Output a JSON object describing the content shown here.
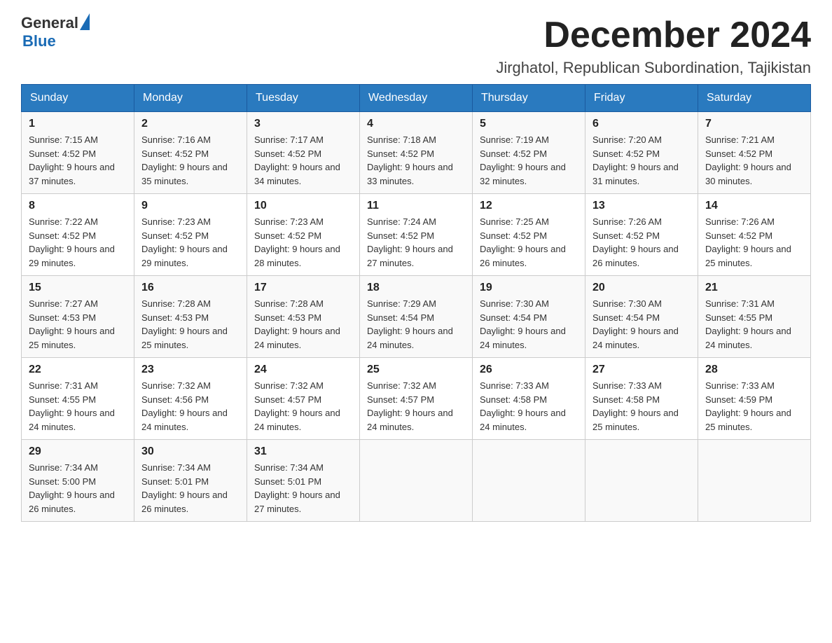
{
  "header": {
    "logo_text_general": "General",
    "logo_text_blue": "Blue",
    "month_title": "December 2024",
    "location": "Jirghatol, Republican Subordination, Tajikistan"
  },
  "days_of_week": [
    "Sunday",
    "Monday",
    "Tuesday",
    "Wednesday",
    "Thursday",
    "Friday",
    "Saturday"
  ],
  "weeks": [
    [
      {
        "day": "1",
        "sunrise": "7:15 AM",
        "sunset": "4:52 PM",
        "daylight": "9 hours and 37 minutes."
      },
      {
        "day": "2",
        "sunrise": "7:16 AM",
        "sunset": "4:52 PM",
        "daylight": "9 hours and 35 minutes."
      },
      {
        "day": "3",
        "sunrise": "7:17 AM",
        "sunset": "4:52 PM",
        "daylight": "9 hours and 34 minutes."
      },
      {
        "day": "4",
        "sunrise": "7:18 AM",
        "sunset": "4:52 PM",
        "daylight": "9 hours and 33 minutes."
      },
      {
        "day": "5",
        "sunrise": "7:19 AM",
        "sunset": "4:52 PM",
        "daylight": "9 hours and 32 minutes."
      },
      {
        "day": "6",
        "sunrise": "7:20 AM",
        "sunset": "4:52 PM",
        "daylight": "9 hours and 31 minutes."
      },
      {
        "day": "7",
        "sunrise": "7:21 AM",
        "sunset": "4:52 PM",
        "daylight": "9 hours and 30 minutes."
      }
    ],
    [
      {
        "day": "8",
        "sunrise": "7:22 AM",
        "sunset": "4:52 PM",
        "daylight": "9 hours and 29 minutes."
      },
      {
        "day": "9",
        "sunrise": "7:23 AM",
        "sunset": "4:52 PM",
        "daylight": "9 hours and 29 minutes."
      },
      {
        "day": "10",
        "sunrise": "7:23 AM",
        "sunset": "4:52 PM",
        "daylight": "9 hours and 28 minutes."
      },
      {
        "day": "11",
        "sunrise": "7:24 AM",
        "sunset": "4:52 PM",
        "daylight": "9 hours and 27 minutes."
      },
      {
        "day": "12",
        "sunrise": "7:25 AM",
        "sunset": "4:52 PM",
        "daylight": "9 hours and 26 minutes."
      },
      {
        "day": "13",
        "sunrise": "7:26 AM",
        "sunset": "4:52 PM",
        "daylight": "9 hours and 26 minutes."
      },
      {
        "day": "14",
        "sunrise": "7:26 AM",
        "sunset": "4:52 PM",
        "daylight": "9 hours and 25 minutes."
      }
    ],
    [
      {
        "day": "15",
        "sunrise": "7:27 AM",
        "sunset": "4:53 PM",
        "daylight": "9 hours and 25 minutes."
      },
      {
        "day": "16",
        "sunrise": "7:28 AM",
        "sunset": "4:53 PM",
        "daylight": "9 hours and 25 minutes."
      },
      {
        "day": "17",
        "sunrise": "7:28 AM",
        "sunset": "4:53 PM",
        "daylight": "9 hours and 24 minutes."
      },
      {
        "day": "18",
        "sunrise": "7:29 AM",
        "sunset": "4:54 PM",
        "daylight": "9 hours and 24 minutes."
      },
      {
        "day": "19",
        "sunrise": "7:30 AM",
        "sunset": "4:54 PM",
        "daylight": "9 hours and 24 minutes."
      },
      {
        "day": "20",
        "sunrise": "7:30 AM",
        "sunset": "4:54 PM",
        "daylight": "9 hours and 24 minutes."
      },
      {
        "day": "21",
        "sunrise": "7:31 AM",
        "sunset": "4:55 PM",
        "daylight": "9 hours and 24 minutes."
      }
    ],
    [
      {
        "day": "22",
        "sunrise": "7:31 AM",
        "sunset": "4:55 PM",
        "daylight": "9 hours and 24 minutes."
      },
      {
        "day": "23",
        "sunrise": "7:32 AM",
        "sunset": "4:56 PM",
        "daylight": "9 hours and 24 minutes."
      },
      {
        "day": "24",
        "sunrise": "7:32 AM",
        "sunset": "4:57 PM",
        "daylight": "9 hours and 24 minutes."
      },
      {
        "day": "25",
        "sunrise": "7:32 AM",
        "sunset": "4:57 PM",
        "daylight": "9 hours and 24 minutes."
      },
      {
        "day": "26",
        "sunrise": "7:33 AM",
        "sunset": "4:58 PM",
        "daylight": "9 hours and 24 minutes."
      },
      {
        "day": "27",
        "sunrise": "7:33 AM",
        "sunset": "4:58 PM",
        "daylight": "9 hours and 25 minutes."
      },
      {
        "day": "28",
        "sunrise": "7:33 AM",
        "sunset": "4:59 PM",
        "daylight": "9 hours and 25 minutes."
      }
    ],
    [
      {
        "day": "29",
        "sunrise": "7:34 AM",
        "sunset": "5:00 PM",
        "daylight": "9 hours and 26 minutes."
      },
      {
        "day": "30",
        "sunrise": "7:34 AM",
        "sunset": "5:01 PM",
        "daylight": "9 hours and 26 minutes."
      },
      {
        "day": "31",
        "sunrise": "7:34 AM",
        "sunset": "5:01 PM",
        "daylight": "9 hours and 27 minutes."
      },
      null,
      null,
      null,
      null
    ]
  ]
}
